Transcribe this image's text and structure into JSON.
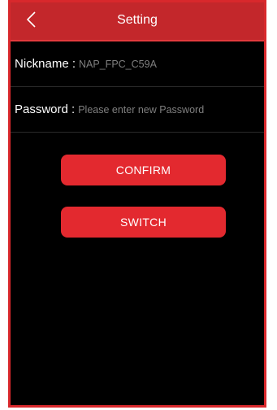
{
  "header": {
    "title": "Setting",
    "back_icon": "chevron-left-icon"
  },
  "form": {
    "nickname_label": "Nickname :",
    "nickname_value": "NAP_FPC_C59A",
    "password_label": "Password :",
    "password_placeholder": "Please enter new Password",
    "password_value": ""
  },
  "buttons": {
    "confirm_label": "CONFIRM",
    "switch_label": "SWITCH"
  },
  "colors": {
    "accent": "#e3292f",
    "header": "#c3272b",
    "border": "#d8282c",
    "background": "#000000",
    "placeholder_text": "#7f7f7f"
  }
}
